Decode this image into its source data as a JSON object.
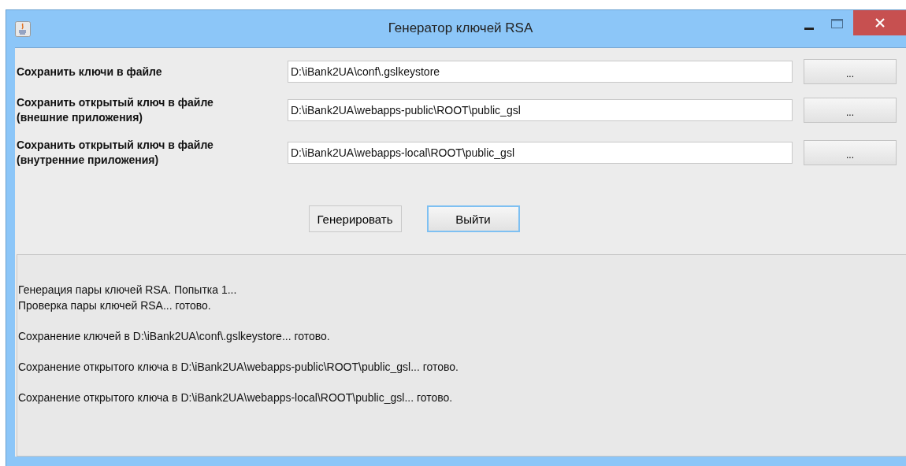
{
  "window": {
    "title": "Генератор ключей RSA"
  },
  "rows": [
    {
      "label": [
        "Сохранить ключи в файле"
      ],
      "value": "D:\\iBank2UA\\conf\\.gslkeystore",
      "browse": "..."
    },
    {
      "label": [
        "Сохранить открытый ключ в файле",
        "(внешние приложения)"
      ],
      "value": "D:\\iBank2UA\\webapps-public\\ROOT\\public_gsl",
      "browse": "..."
    },
    {
      "label": [
        "Сохранить открытый ключ в файле",
        "(внутренние приложения)"
      ],
      "value": "D:\\iBank2UA\\webapps-local\\ROOT\\public_gsl",
      "browse": "..."
    }
  ],
  "buttons": [
    {
      "label": "Генерировать",
      "focused": false
    },
    {
      "label": "Выйти",
      "focused": true
    }
  ],
  "log": [
    [
      "Генерация пары ключей RSA. Попытка 1...",
      "Проверка пары ключей RSA... готово."
    ],
    [
      "Сохранение ключей в D:\\iBank2UA\\conf\\.gslkeystore... готово."
    ],
    [
      "Сохранение открытого ключа в D:\\iBank2UA\\webapps-public\\ROOT\\public_gsl... готово."
    ],
    [
      "Сохранение открытого ключа в D:\\iBank2UA\\webapps-local\\ROOT\\public_gsl... готово."
    ]
  ]
}
